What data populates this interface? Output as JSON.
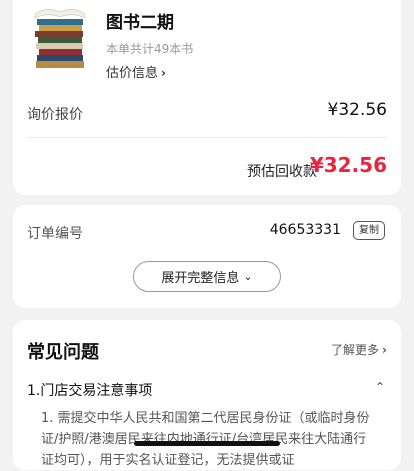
{
  "order": {
    "title": "图书二期",
    "book_count_text": "本单共计49本书",
    "estimate_link_label": "估价信息",
    "price_label": "询价报价",
    "price_value": "¥32.56",
    "recovery_label": "预估回收款",
    "recovery_value": "¥32.56"
  },
  "order_info": {
    "order_no_label": "订单编号",
    "order_no_value": "46653331",
    "copy_label": "复制",
    "expand_label": "展开完整信息"
  },
  "faq": {
    "title": "常见问题",
    "more_label": "了解更多",
    "q1_title": "1.门店交易注意事项",
    "q1_answer": "1. 需提交中华人民共和国第二代居民身份证（或临时身份证/护照/港澳居民来往内地通行证/台湾居民来往大陆通行证均可），用于实名认证登记，无法提供或证"
  },
  "colors": {
    "accent_red": "#e8243f",
    "background": "#f2f2f2"
  },
  "icons": {
    "chevron_right": "›",
    "chevron_down": "⌄",
    "chevron_up": "⌃"
  }
}
